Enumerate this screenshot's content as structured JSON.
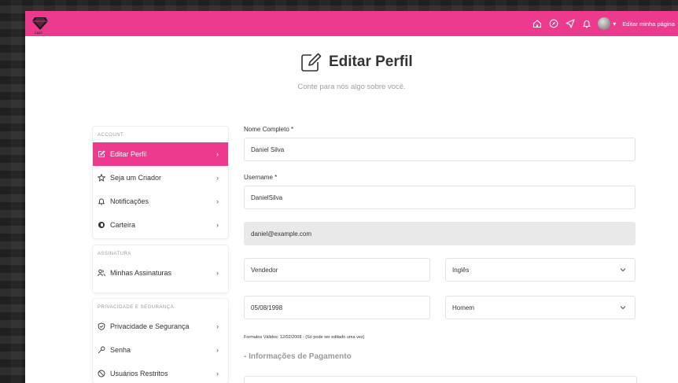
{
  "topbar": {
    "brand_color": "#ec3a8f",
    "icons": [
      "home-icon",
      "compass-icon",
      "send-icon",
      "bell-icon"
    ],
    "edit_link": "Editar minha página"
  },
  "header": {
    "title": "Editar Perfil",
    "subtitle": "Conte para nós algo sobre você."
  },
  "sidebar": {
    "account": {
      "heading": "ACCOUNT",
      "items": [
        {
          "label": "Editar Perfil",
          "icon": "edit-icon",
          "active": true
        },
        {
          "label": "Seja um Criador",
          "icon": "star-icon"
        },
        {
          "label": "Notificações",
          "icon": "bell-icon"
        },
        {
          "label": "Carteira",
          "icon": "wallet-icon"
        }
      ]
    },
    "subscription": {
      "heading": "ASSINATURA",
      "items": [
        {
          "label": "Minhas Assinaturas",
          "icon": "users-icon"
        }
      ]
    },
    "privacy": {
      "heading": "PRIVACIDADE E SEGURANÇA",
      "items": [
        {
          "label": "Privacidade e Segurança",
          "icon": "shield-icon"
        },
        {
          "label": "Senha",
          "icon": "key-icon"
        },
        {
          "label": "Usuários Restritos",
          "icon": "block-icon"
        }
      ]
    }
  },
  "form": {
    "full_name_label": "Nome Completo *",
    "full_name": "Daniel Silva",
    "username_label": "Username *",
    "username": "DanielSilva",
    "email": "daniel@example.com",
    "occupation": "Vendedor",
    "language": "Inglês",
    "birthdate": "05/08/1998",
    "gender": "Homem",
    "date_hint": "Formatos Válidos: 12/02/2008 - (Só pode ser editado uma vez)",
    "payment_section": "- Informações de Pagamento"
  }
}
